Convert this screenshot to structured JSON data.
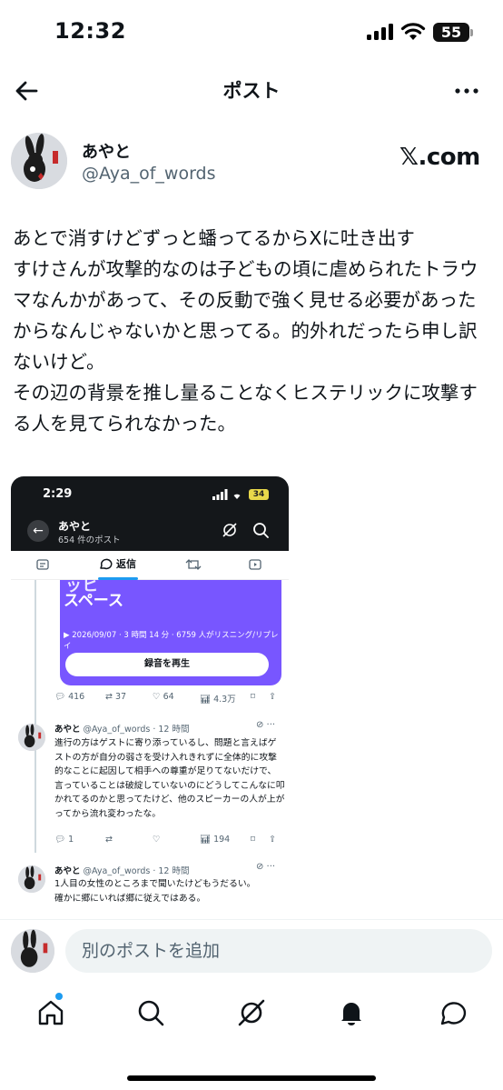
{
  "status_bar": {
    "time": "12:32",
    "battery": "55"
  },
  "header": {
    "title": "ポスト"
  },
  "author": {
    "name": "あやと",
    "handle": "@Aya_of_words",
    "source": "𝕏.com"
  },
  "post": {
    "text": "あとで消すけどずっと蟠ってるからXに吐き出す\nすけさんが攻撃的なのは子どもの頃に虐められたトラウマなんかがあって、その反動で強く見せる必要があったからなんじゃないかと思ってる。的外れだったら申し訳ないけど。\nその辺の背景を推し量ることなくヒステリックに攻撃する人を見てられなかった。"
  },
  "embedded_screenshot": {
    "time": "2:29",
    "battery": "34",
    "profile_name": "あやと",
    "post_count": "654 件のポスト",
    "tab_active": "返信",
    "space_card": {
      "title_partial": "ッヒ",
      "title": "スペース",
      "meta": "2026/09/07 · 3 時間 14 分 · 6759 人がリスニング/リプレイ",
      "button": "録音を再生"
    },
    "card_actions": {
      "replies": "416",
      "reposts": "37",
      "likes": "64",
      "views": "4.3万"
    },
    "reply1": {
      "name": "あやと",
      "meta": "@Aya_of_words · 12 時間",
      "text": "進行の方はゲストに寄り添っているし、問題と言えばゲストの方が自分の弱さを受け入れきれずに全体的に攻撃的なことに起因して相手への尊重が足りてないだけで、言っていることは破綻していないのにどうしてこんなに叩かれてるのかと思ってたけど、他のスピーカーの人が上がってから流れ変わったな。",
      "replies": "1",
      "views": "194"
    },
    "reply2": {
      "name": "あやと",
      "meta": "@Aya_of_words · 12 時間",
      "text": "1人目の女性のところまで聞いたけどもうだるい。\n確かに郷にいれば郷に従えではある。"
    }
  },
  "composer": {
    "placeholder": "別のポストを追加"
  },
  "nav": [
    "home-icon",
    "search-icon",
    "grok-icon",
    "notifications-icon",
    "messages-icon"
  ],
  "colors": {
    "accent": "#1d9bf0",
    "space_purple": "#7856ff",
    "text": "#0f1419",
    "secondary": "#536471"
  }
}
